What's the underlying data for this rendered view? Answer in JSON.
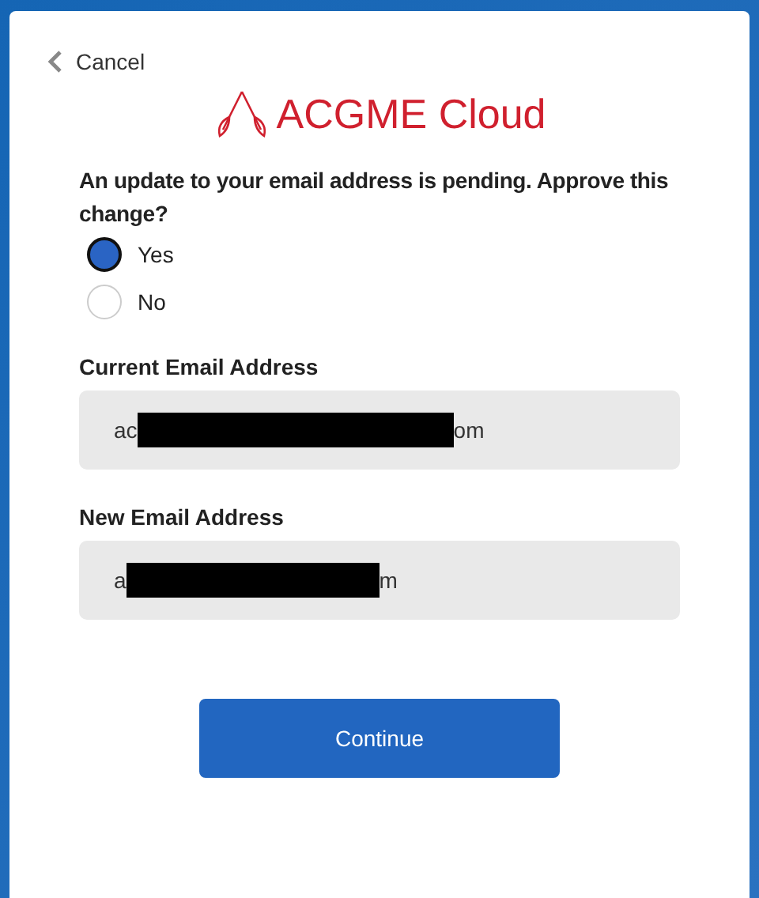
{
  "cancel": "Cancel",
  "logo": "ACGME Cloud",
  "question": "An update to your email address is pending. Approve this change?",
  "options": [
    {
      "label": "Yes",
      "selected": true
    },
    {
      "label": "No",
      "selected": false
    }
  ],
  "fields": [
    {
      "label": "Current Email Address",
      "value_start": "ac",
      "redacted": true,
      "value_end": "om"
    },
    {
      "label": "New Email Address",
      "value_start": "a",
      "redacted": true,
      "value_end": "m"
    }
  ],
  "button": "Continue"
}
